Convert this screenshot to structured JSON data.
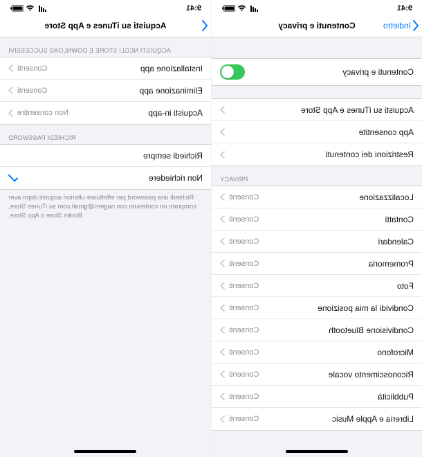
{
  "status": {
    "time": "9:41"
  },
  "right": {
    "back_label": "Indietro",
    "title": "Contenuti e privacy",
    "toggle_label": "Contenuti e privacy",
    "items": [
      {
        "label": "Acquisti su iTunes e App Store"
      },
      {
        "label": "App consentite"
      },
      {
        "label": "Restrizioni dei contenuti"
      }
    ],
    "privacy_header": "PRIVACY",
    "privacy": [
      {
        "label": "Localizzazione",
        "detail": "Consenti"
      },
      {
        "label": "Contatti",
        "detail": "Consenti"
      },
      {
        "label": "Calendari",
        "detail": "Consenti"
      },
      {
        "label": "Promemoria",
        "detail": "Consenti"
      },
      {
        "label": "Foto",
        "detail": "Consenti"
      },
      {
        "label": "Condividi la mia posizione",
        "detail": "Consenti"
      },
      {
        "label": "Condivisione Bluetooth",
        "detail": "Consenti"
      },
      {
        "label": "Microfono",
        "detail": "Consenti"
      },
      {
        "label": "Riconoscimento vocale",
        "detail": "Consenti"
      },
      {
        "label": "Pubblicità",
        "detail": "Consenti"
      },
      {
        "label": "Libreria e Apple Music",
        "detail": "Consenti"
      }
    ]
  },
  "left": {
    "title": "Acquisti su iTunes e App Store",
    "section1_header": "ACQUISTI NEGLI STORE E DOWNLOAD SUCCESSIVI",
    "items": [
      {
        "label": "Installazione app",
        "detail": "Consenti"
      },
      {
        "label": "Eliminazione app",
        "detail": "Consenti"
      },
      {
        "label": "Acquisti in-app",
        "detail": "Non consentire"
      }
    ],
    "section2_header": "RICHIEDI PASSWORD",
    "opts": [
      {
        "label": "Richiedi sempre",
        "selected": false
      },
      {
        "label": "Non richiedere",
        "selected": true
      }
    ],
    "footnote": "Richiedi una password per effettuare ulteriori acquisti dopo aver comprato un contenuto con nagern@gmail.com su iTunes Store, Books Store o App Store."
  }
}
